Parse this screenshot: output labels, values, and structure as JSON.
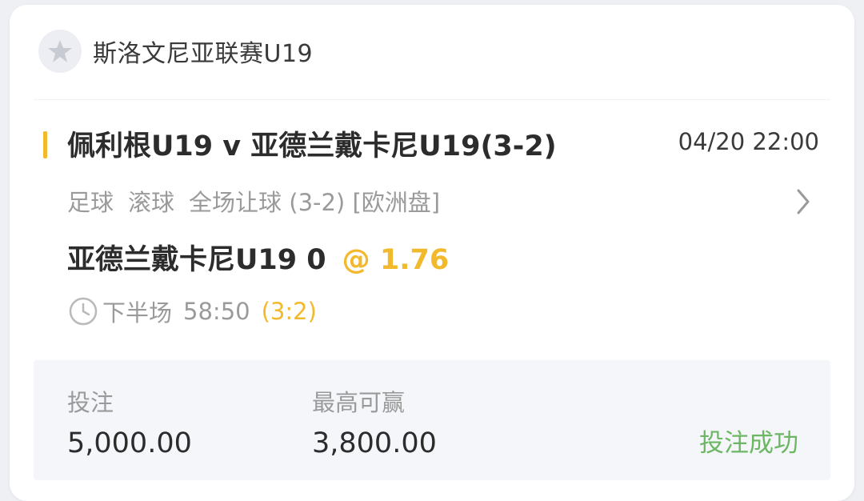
{
  "league": {
    "name": "斯洛文尼亚联赛U19",
    "logo_icon": "star-badge-icon"
  },
  "match": {
    "title": "佩利根U19 v 亚德兰戴卡尼U19(3-2)",
    "time": "04/20 22:00",
    "sport": "足球",
    "mode": "滚球",
    "market": "全场让球 (3-2) [欧洲盘]"
  },
  "selection": {
    "name": "亚德兰戴卡尼U19 0",
    "odds": "@ 1.76"
  },
  "status": {
    "period": "下半场",
    "clock": "58:50",
    "score": "(3:2)"
  },
  "bet": {
    "stake_label": "投注",
    "stake_value": "5,000.00",
    "max_win_label": "最高可赢",
    "max_win_value": "3,800.00",
    "result": "投注成功"
  },
  "colors": {
    "accent": "#f2b92c",
    "success": "#6db764",
    "text_primary": "#2c2c2c",
    "text_secondary": "#9a9a9a"
  }
}
